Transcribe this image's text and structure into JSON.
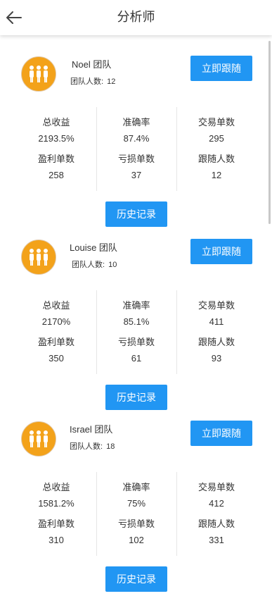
{
  "header": {
    "title": "分析师"
  },
  "labels": {
    "member_prefix": "团队人数:",
    "follow": "立即跟随",
    "history": "历史记录",
    "total_profit": "总收益",
    "accuracy": "准确率",
    "trades": "交易单数",
    "win_trades": "盈利单数",
    "loss_trades": "亏损单数",
    "followers": "跟随人数"
  },
  "teams": [
    {
      "name": "Noel 团队",
      "members": "12",
      "total_profit": "2193.5%",
      "accuracy": "87.4%",
      "trades": "295",
      "win_trades": "258",
      "loss_trades": "37",
      "followers": "12"
    },
    {
      "name": "Louise 团队",
      "members": "10",
      "total_profit": "2170%",
      "accuracy": "85.1%",
      "trades": "411",
      "win_trades": "350",
      "loss_trades": "61",
      "followers": "93"
    },
    {
      "name": "Israel 团队",
      "members": "18",
      "total_profit": "1581.2%",
      "accuracy": "75%",
      "trades": "412",
      "win_trades": "310",
      "loss_trades": "102",
      "followers": "331"
    }
  ],
  "colors": {
    "accent": "#2196f3",
    "avatar": "#f3a21a"
  },
  "icons": {
    "back": "arrow-left-icon",
    "avatar": "team-people-icon"
  }
}
